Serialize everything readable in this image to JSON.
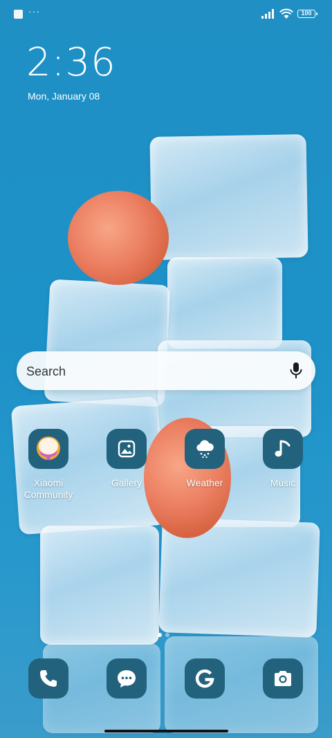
{
  "status_bar": {
    "overflow_indicator": "···",
    "battery": "100"
  },
  "clock": {
    "time": "2:36",
    "date": "Mon, January 08"
  },
  "search": {
    "placeholder": "Search"
  },
  "apps": [
    {
      "label": "Xiaomi Community",
      "icon": "xiaomi-community-icon"
    },
    {
      "label": "Gallery",
      "icon": "gallery-icon"
    },
    {
      "label": "Weather",
      "icon": "weather-icon"
    },
    {
      "label": "Music",
      "icon": "music-icon"
    }
  ],
  "dock": [
    {
      "icon": "phone-icon"
    },
    {
      "icon": "messages-icon"
    },
    {
      "icon": "google-icon"
    },
    {
      "icon": "camera-icon"
    }
  ],
  "colors": {
    "wallpaper": "#1f8fc4",
    "icon_background": "#22627c"
  }
}
